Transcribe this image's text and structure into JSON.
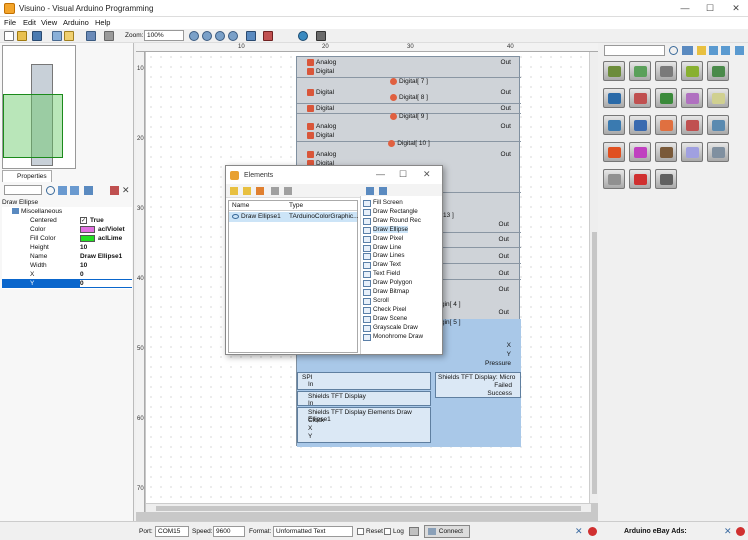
{
  "window": {
    "title": "Visuino - Visual Arduino Programming",
    "minimize": "—",
    "maximize": "☐",
    "close": "✕"
  },
  "menu": [
    "File",
    "Edit",
    "View",
    "Arduino",
    "Help"
  ],
  "toolbar": {
    "zoom_label": "Zoom:",
    "zoom_value": "100%"
  },
  "ruler": {
    "top": [
      "10",
      "20",
      "30",
      "40"
    ],
    "left": [
      "10",
      "20",
      "30",
      "40",
      "50",
      "60",
      "70"
    ]
  },
  "properties": {
    "tab_label": "Properties",
    "title": "Draw Ellipse",
    "rows": [
      {
        "name": "Miscellaneous",
        "value": ""
      },
      {
        "name": "Centered",
        "value": "True"
      },
      {
        "name": "Color",
        "value": "aclViolet",
        "color": "#e070e0"
      },
      {
        "name": "Fill Color",
        "value": "aclLime",
        "color": "#22dd22"
      },
      {
        "name": "Height",
        "value": "10"
      },
      {
        "name": "Name",
        "value": "Draw Ellipse1"
      },
      {
        "name": "Width",
        "value": "10"
      },
      {
        "name": "X",
        "value": "0"
      },
      {
        "name": "Y",
        "value": "0"
      }
    ]
  },
  "component": {
    "rows": [
      {
        "left": "Analog",
        "right": "Out"
      },
      {
        "left": "Digital",
        "right": ""
      },
      {
        "header": "Digital[ 7 ]"
      },
      {
        "left": "Digital",
        "right": "Out"
      },
      {
        "header": "Digital[ 8 ]"
      },
      {
        "left": "Digital",
        "right": "Out"
      },
      {
        "header": "Digital[ 9 ]"
      },
      {
        "left": "Analog",
        "right": "Out"
      },
      {
        "left": "Digital",
        "right": ""
      },
      {
        "header": "Digital[ 10 ]"
      },
      {
        "left": "Analog",
        "right": "Out"
      },
      {
        "left": "Digital",
        "right": ""
      }
    ],
    "partial_labels": [
      "13 ]",
      "gin[ 4 ]",
      "gin[ 5 ]"
    ],
    "out_label": "Out",
    "lower": {
      "xy_x": "X",
      "xy_y": "Y",
      "pressure": "Pressure",
      "spi": "SPI",
      "in": "In",
      "tft_display": "Shields TFT Display",
      "tft_micro": "Shields TFT Display: Micro",
      "failed": "Failed",
      "success": "Success",
      "elements_ellipse": "Shields TFT Display Elements Draw Ellipse1",
      "clock": "Clock",
      "x": "X",
      "y": "Y"
    }
  },
  "elements_window": {
    "title": "Elements",
    "columns": [
      "Name",
      "Type"
    ],
    "row": {
      "name": "Draw Ellipse1",
      "type": "TArduinoColorGraphic..."
    },
    "tools": [
      "Fill Screen",
      "Draw Rectangle",
      "Draw Round Rec",
      "Draw Ellipse",
      "Draw Pixel",
      "Draw Line",
      "Draw Lines",
      "Draw Text",
      "Text Field",
      "Draw Polygon",
      "Draw Bitmap",
      "Scroll",
      "Check Pixel",
      "Draw Scene",
      "Grayscale Draw",
      "Monohrome Draw"
    ],
    "selected_tool": "Draw Ellipse"
  },
  "statusbar": {
    "port_label": "Port:",
    "port_value": "COM15",
    "speed_label": "Speed:",
    "speed_value": "9600",
    "format_label": "Format:",
    "format_value": "Unformatted Text",
    "reset_label": "Reset",
    "log_label": "Log",
    "connect_label": "Connect",
    "ebay_label": "Arduino eBay Ads:"
  },
  "palette_colors": [
    "#6c8c3a",
    "#5aa05a",
    "#7a7a7a",
    "#88b030",
    "#4a8a4a",
    "#2a6aa8",
    "#c05050",
    "#3a8a3a",
    "#b070c0",
    "#d0d090",
    "#3a7ab0",
    "#3a6ab0",
    "#e07040",
    "#c05050",
    "#5a8ab0",
    "#e05020",
    "#c040c0",
    "#7a5a3a",
    "#a0a0e0",
    "#8090a0",
    "#909090",
    "#d03030",
    "#606060"
  ]
}
